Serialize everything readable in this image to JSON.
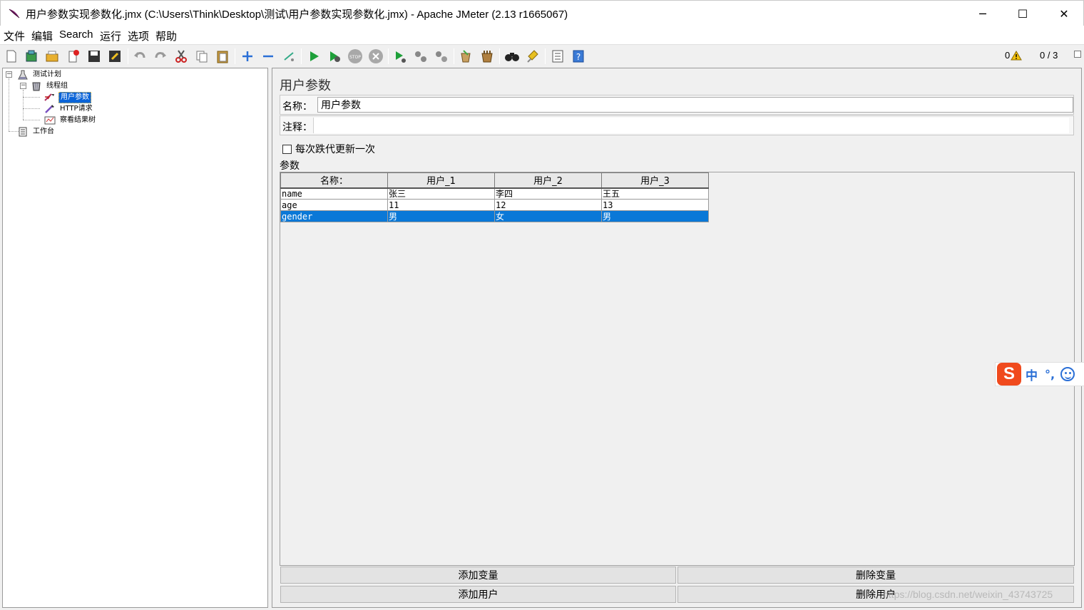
{
  "window": {
    "title": "用户参数实现参数化.jmx (C:\\Users\\Think\\Desktop\\测试\\用户参数实现参数化.jmx) - Apache JMeter (2.13 r1665067)",
    "minimize_glyph": "─",
    "maximize_glyph": "☐",
    "close_glyph": "✕"
  },
  "menu": {
    "items": [
      "文件",
      "编辑",
      "Search",
      "运行",
      "选项",
      "帮助"
    ]
  },
  "toolbar": {
    "warning_count": "0",
    "threads": "0 / 3"
  },
  "tree": {
    "nodes": [
      {
        "label": "测试计划",
        "icon": "flask-icon"
      },
      {
        "label": "线程组",
        "icon": "thread-group-icon"
      },
      {
        "label": "用户参数",
        "icon": "user-params-icon"
      },
      {
        "label": "HTTP请求",
        "icon": "pipette-icon"
      },
      {
        "label": "察看结果树",
        "icon": "results-tree-icon"
      },
      {
        "label": "工作台",
        "icon": "workbench-icon"
      }
    ]
  },
  "panel": {
    "title": "用户参数",
    "name_label": "名称：",
    "name_value": "用户参数",
    "comment_label": "注释：",
    "comment_value": "",
    "update_once_label": "每次跌代更新一次",
    "params_label": "参数"
  },
  "table": {
    "headers": [
      "名称：",
      "用户_1",
      "用户_2",
      "用户_3"
    ],
    "rows": [
      [
        "name",
        "张三",
        "李四",
        "王五"
      ],
      [
        "age",
        "11",
        "12",
        "13"
      ],
      [
        "gender",
        "男",
        "女",
        "男"
      ]
    ],
    "selected_row": 2
  },
  "buttons": {
    "add_variable": "添加变量",
    "delete_variable": "删除变量",
    "add_user": "添加用户",
    "delete_user": "删除用户"
  },
  "ime": {
    "logo": "S",
    "mode": "中",
    "punct": "°,"
  },
  "watermark": "https://blog.csdn.net/weixin_43743725"
}
